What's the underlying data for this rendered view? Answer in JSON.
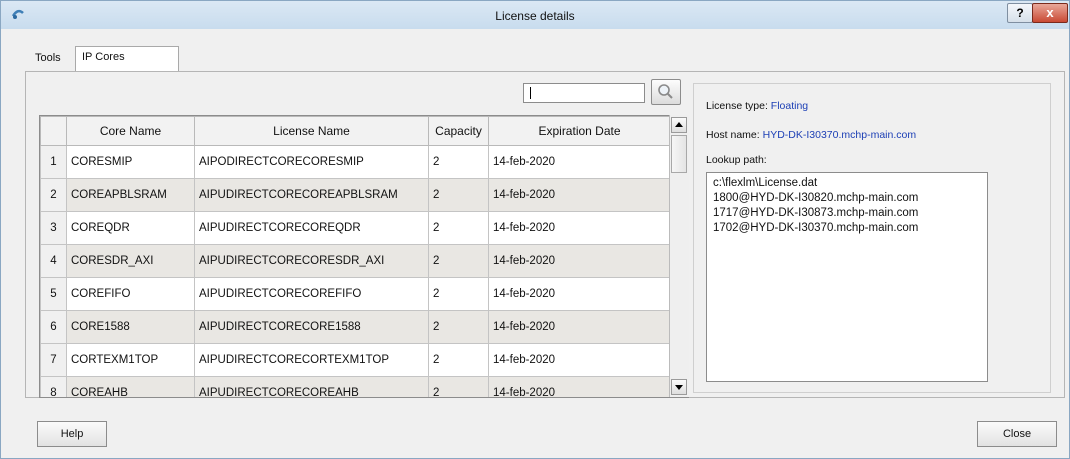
{
  "window": {
    "title": "License details"
  },
  "title_buttons": {
    "help": "?",
    "close": "x"
  },
  "tabs": [
    {
      "label": "Tools",
      "active": false
    },
    {
      "label": "IP Cores",
      "active": true
    }
  ],
  "search": {
    "value": "",
    "placeholder": ""
  },
  "table": {
    "columns": [
      "Core Name",
      "License Name",
      "Capacity",
      "Expiration Date"
    ],
    "rows": [
      {
        "index": "1",
        "core": "CORESMIP",
        "license": "AIPODIRECTCORECORESMIP",
        "capacity": "2",
        "expiration": "14-feb-2020"
      },
      {
        "index": "2",
        "core": "COREAPBLSRAM",
        "license": "AIPUDIRECTCORECOREAPBLSRAM",
        "capacity": "2",
        "expiration": "14-feb-2020"
      },
      {
        "index": "3",
        "core": "COREQDR",
        "license": "AIPUDIRECTCORECOREQDR",
        "capacity": "2",
        "expiration": "14-feb-2020"
      },
      {
        "index": "4",
        "core": "CORESDR_AXI",
        "license": "AIPUDIRECTCORECORESDR_AXI",
        "capacity": "2",
        "expiration": "14-feb-2020"
      },
      {
        "index": "5",
        "core": "COREFIFO",
        "license": "AIPUDIRECTCORECOREFIFO",
        "capacity": "2",
        "expiration": "14-feb-2020"
      },
      {
        "index": "6",
        "core": "CORE1588",
        "license": "AIPUDIRECTCORECORE1588",
        "capacity": "2",
        "expiration": "14-feb-2020"
      },
      {
        "index": "7",
        "core": "CORTEXM1TOP",
        "license": "AIPUDIRECTCORECORTEXM1TOP",
        "capacity": "2",
        "expiration": "14-feb-2020"
      },
      {
        "index": "8",
        "core": "COREAHB",
        "license": "AIPUDIRECTCORECOREAHB",
        "capacity": "2",
        "expiration": "14-feb-2020"
      }
    ]
  },
  "info": {
    "license_type_label": "License type:",
    "license_type_value": "Floating",
    "host_name_label": "Host name:",
    "host_name_value": "HYD-DK-I30370.mchp-main.com",
    "lookup_path_label": "Lookup path:",
    "lookup_paths": [
      "c:\\flexlm\\License.dat",
      "1800@HYD-DK-I30820.mchp-main.com",
      "1717@HYD-DK-I30873.mchp-main.com",
      "1702@HYD-DK-I30370.mchp-main.com"
    ]
  },
  "footer": {
    "help_label": "Help",
    "close_label": "Close"
  },
  "colors": {
    "title_bg": "#cfe0ee",
    "value_text": "#1c3fb5",
    "close_button": "#c94a34"
  },
  "icons": [
    "app-icon",
    "search-icon",
    "scroll-up-icon",
    "scroll-down-icon"
  ]
}
